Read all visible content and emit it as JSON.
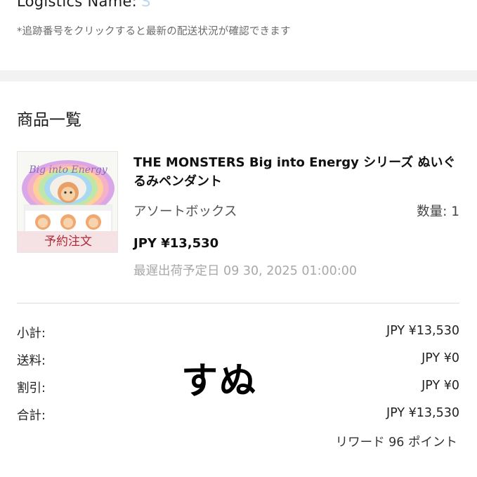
{
  "logistics": {
    "name_label": "Logistics Name:",
    "name_value": "S",
    "note": "*追跡番号をクリックすると最新の配送状況が確認できます"
  },
  "items_section": {
    "title": "商品一覧",
    "product": {
      "name": "THE MONSTERS Big into Energy シリーズ ぬいぐるみペンダント",
      "variant": "アソートボックス",
      "quantity": "数量: 1",
      "price": "JPY ¥13,530",
      "ship_date": "最遅出荷予定日 09 30, 2025 01:00:00",
      "badge": "予約注文",
      "thumbnail_text": "Big into Energy"
    }
  },
  "summary": {
    "rows": [
      {
        "label": "小計:",
        "amount": "JPY ¥13,530"
      },
      {
        "label": "送料:",
        "amount": "JPY ¥0"
      },
      {
        "label": "割引:",
        "amount": "JPY ¥0"
      },
      {
        "label": "合計:",
        "amount": "JPY ¥13,530"
      }
    ],
    "reward": "リワード 96 ポイント"
  },
  "overlay_text": "すぬ"
}
